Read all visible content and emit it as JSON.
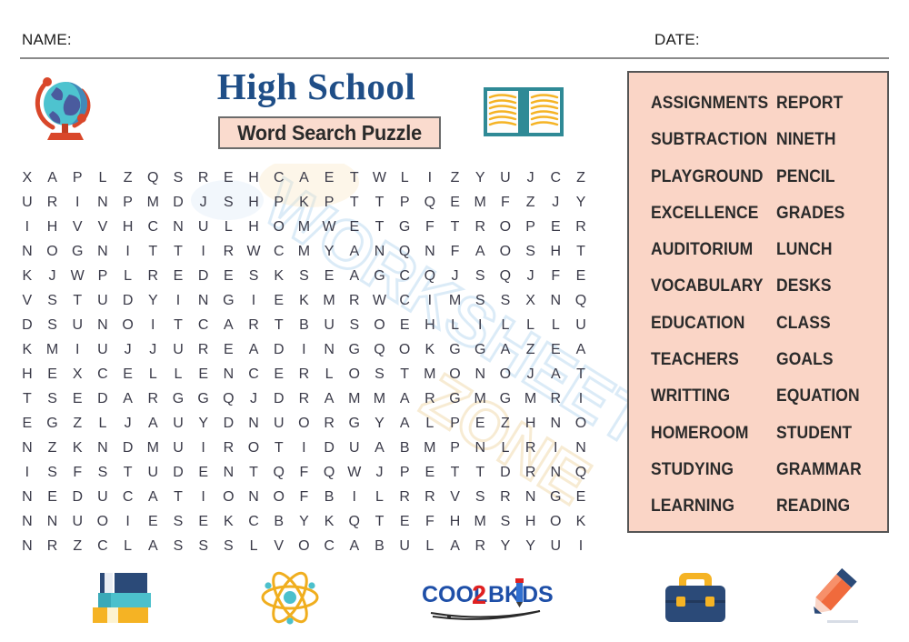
{
  "header": {
    "name_label": "NAME:",
    "date_label": "DATE:"
  },
  "title": {
    "main": "High School",
    "subtitle": "Word Search Puzzle",
    "globe_icon": "globe-icon",
    "book_icon": "open-book-icon"
  },
  "watermark": {
    "text": "WORKSHEET",
    "secondary": "ZONE",
    "color": "#cfe4f5"
  },
  "colors": {
    "title_blue": "#1f4e87",
    "panel_peach": "#fad5c6",
    "panel_border": "#555555",
    "letter_ink": "#3a3a48",
    "rule_gray": "#8a8a8a"
  },
  "puzzle": {
    "rows": 16,
    "cols": 24,
    "grid": [
      [
        "X",
        "A",
        "P",
        "L",
        "Z",
        "Q",
        "S",
        "R",
        "E",
        "H",
        "C",
        "A",
        "E",
        "T",
        "W",
        "L",
        "I",
        "Z",
        "Y",
        "U",
        "J",
        "C",
        "Z",
        ""
      ],
      [
        "U",
        "R",
        "I",
        "N",
        "P",
        "M",
        "D",
        "J",
        "S",
        "H",
        "P",
        "K",
        "P",
        "T",
        "T",
        "P",
        "Q",
        "E",
        "M",
        "F",
        "Z",
        "J",
        "Y",
        ""
      ],
      [
        "I",
        "H",
        "V",
        "V",
        "H",
        "C",
        "N",
        "U",
        "L",
        "H",
        "O",
        "M",
        "W",
        "E",
        "T",
        "G",
        "F",
        "T",
        "R",
        "O",
        "P",
        "E",
        "R",
        ""
      ],
      [
        "N",
        "O",
        "G",
        "N",
        "I",
        "T",
        "T",
        "I",
        "R",
        "W",
        "C",
        "M",
        "Y",
        "A",
        "N",
        "Q",
        "N",
        "F",
        "A",
        "O",
        "S",
        "H",
        "T",
        ""
      ],
      [
        "K",
        "J",
        "W",
        "P",
        "L",
        "R",
        "E",
        "D",
        "E",
        "S",
        "K",
        "S",
        "E",
        "A",
        "G",
        "C",
        "Q",
        "J",
        "S",
        "Q",
        "J",
        "F",
        "E",
        ""
      ],
      [
        "V",
        "S",
        "T",
        "U",
        "D",
        "Y",
        "I",
        "N",
        "G",
        "I",
        "E",
        "K",
        "M",
        "R",
        "W",
        "C",
        "I",
        "M",
        "S",
        "S",
        "X",
        "N",
        "Q",
        ""
      ],
      [
        "D",
        "S",
        "U",
        "N",
        "O",
        "I",
        "T",
        "C",
        "A",
        "R",
        "T",
        "B",
        "U",
        "S",
        "O",
        "E",
        "H",
        "L",
        "I",
        "L",
        "L",
        "L",
        "U",
        ""
      ],
      [
        "K",
        "M",
        "I",
        "U",
        "J",
        "J",
        "U",
        "R",
        "E",
        "A",
        "D",
        "I",
        "N",
        "G",
        "Q",
        "O",
        "K",
        "G",
        "G",
        "A",
        "Z",
        "E",
        "A",
        ""
      ],
      [
        "H",
        "E",
        "X",
        "C",
        "E",
        "L",
        "L",
        "E",
        "N",
        "C",
        "E",
        "R",
        "L",
        "O",
        "S",
        "T",
        "M",
        "O",
        "N",
        "O",
        "J",
        "A",
        "T",
        ""
      ],
      [
        "T",
        "S",
        "E",
        "D",
        "A",
        "R",
        "G",
        "G",
        "Q",
        "J",
        "D",
        "R",
        "A",
        "M",
        "M",
        "A",
        "R",
        "G",
        "M",
        "G",
        "M",
        "R",
        "I",
        ""
      ],
      [
        "E",
        "G",
        "Z",
        "L",
        "J",
        "A",
        "U",
        "Y",
        "D",
        "N",
        "U",
        "O",
        "R",
        "G",
        "Y",
        "A",
        "L",
        "P",
        "E",
        "Z",
        "H",
        "N",
        "O",
        ""
      ],
      [
        "N",
        "Z",
        "K",
        "N",
        "D",
        "M",
        "U",
        "I",
        "R",
        "O",
        "T",
        "I",
        "D",
        "U",
        "A",
        "B",
        "M",
        "P",
        "N",
        "L",
        "R",
        "I",
        "N",
        ""
      ],
      [
        "I",
        "S",
        "F",
        "S",
        "T",
        "U",
        "D",
        "E",
        "N",
        "T",
        "Q",
        "F",
        "Q",
        "W",
        "J",
        "P",
        "E",
        "T",
        "T",
        "D",
        "R",
        "N",
        "Q",
        ""
      ],
      [
        "N",
        "E",
        "D",
        "U",
        "C",
        "A",
        "T",
        "I",
        "O",
        "N",
        "O",
        "F",
        "B",
        "I",
        "L",
        "R",
        "R",
        "V",
        "S",
        "R",
        "N",
        "G",
        "E",
        ""
      ],
      [
        "N",
        "N",
        "U",
        "O",
        "I",
        "E",
        "S",
        "E",
        "K",
        "C",
        "B",
        "Y",
        "K",
        "Q",
        "T",
        "E",
        "F",
        "H",
        "M",
        "S",
        "H",
        "O",
        "K",
        ""
      ],
      [
        "N",
        "R",
        "Z",
        "C",
        "L",
        "A",
        "S",
        "S",
        "S",
        "L",
        "V",
        "O",
        "C",
        "A",
        "B",
        "U",
        "L",
        "A",
        "R",
        "Y",
        "Y",
        "U",
        "I",
        ""
      ]
    ]
  },
  "wordlist": {
    "words": [
      "ASSIGNMENTS",
      "REPORT",
      "SUBTRACTION",
      "NINETH",
      "PLAYGROUND",
      "PENCIL",
      "EXCELLENCE",
      "GRADES",
      "AUDITORIUM",
      "LUNCH",
      "VOCABULARY",
      "DESKS",
      "EDUCATION",
      "CLASS",
      "TEACHERS",
      "GOALS",
      "WRITTING",
      "EQUATION",
      "HOMEROOM",
      "STUDENT",
      "STUDYING",
      "GRAMMAR",
      "LEARNING",
      "READING"
    ]
  },
  "footer": {
    "icons": [
      "books-icon",
      "atom-icon",
      "cool2bkids-logo",
      "briefcase-icon",
      "pencil-icon"
    ],
    "logo": {
      "part1": "COOL",
      "part2": "2",
      "part3": "BK",
      "part4": "DS"
    }
  }
}
